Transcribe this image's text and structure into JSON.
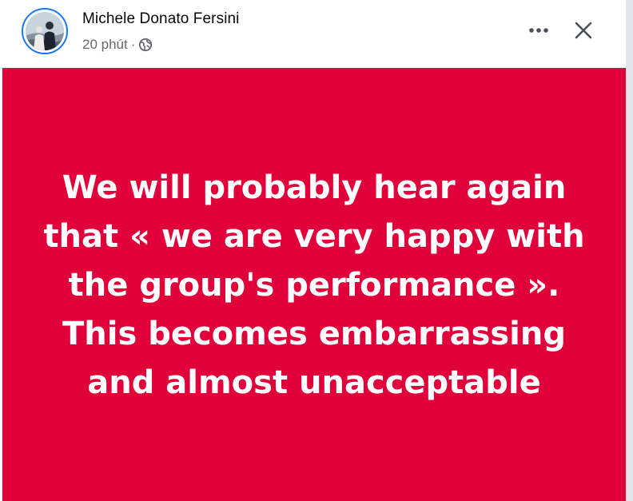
{
  "post": {
    "author": "Michele Donato Fersini",
    "time": "20 phút",
    "separator": "·",
    "privacy_icon": "globe-icon",
    "menu_icon": "more-options-icon",
    "close_icon": "close-icon",
    "text": "We will probably hear again\nthat « we are very happy with\nthe group's performance ».\nThis becomes embarrassing\nand almost unacceptable",
    "background_color": "#e0003a",
    "text_color": "#ffffff"
  }
}
